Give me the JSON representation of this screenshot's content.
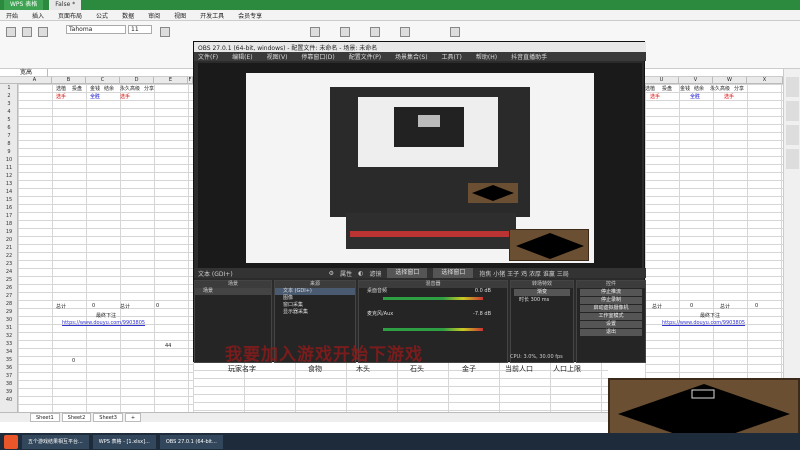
{
  "wps": {
    "app_tab": "WPS 表格",
    "doc_tab": "False *",
    "menu": [
      "开始",
      "插入",
      "页面布局",
      "公式",
      "数据",
      "审阅",
      "视图",
      "开发工具",
      "会员专享"
    ],
    "font": "Tahoma",
    "font_size": "11",
    "cell_ref": "宽高",
    "columns_left": [
      "A",
      "B",
      "C",
      "D",
      "E",
      "F"
    ],
    "columns_right": [
      "U",
      "V",
      "W",
      "X"
    ],
    "rows": [
      "1",
      "2",
      "3",
      "4",
      "5",
      "6",
      "7",
      "8",
      "9",
      "10",
      "11",
      "12",
      "13",
      "14",
      "15",
      "16",
      "17",
      "18",
      "19",
      "20",
      "21",
      "22",
      "23",
      "24",
      "25",
      "26",
      "27",
      "28",
      "29",
      "30",
      "31",
      "32",
      "33",
      "34",
      "35",
      "36",
      "37",
      "38",
      "39",
      "40"
    ],
    "header_row": [
      "选植",
      "投盘",
      "金钱",
      "结余",
      "永久高级",
      "分享"
    ],
    "sub_row": [
      "选手",
      "全胜",
      "选手"
    ],
    "totals": [
      "总计",
      "0",
      "总计",
      "0"
    ],
    "hint": "最终下注",
    "link": "https://www.douyu.com/9903805",
    "value_44": "44",
    "value_0": "0",
    "sheets": [
      "Sheet1",
      "Sheet2",
      "Sheet3",
      "+"
    ]
  },
  "obs": {
    "title": "OBS 27.0.1 (64-bit, windows) - 配置文件: 未命名 - 场景: 未命名",
    "menu": [
      "文件(F)",
      "编辑(E)",
      "视图(V)",
      "停靠窗口(D)",
      "配置文件(P)",
      "场景集合(S)",
      "工具(T)",
      "帮助(H)",
      "抖音直播助手"
    ],
    "status_label": "文本 (GDI+)",
    "props_btn": "属性",
    "filter_btn": "滤镜",
    "select_window": "选择窗口",
    "select_window2": "选择窗口",
    "scroll_text": "抱焦 小猪 王子 鸡 浓厚 谁赢 三局",
    "docks": {
      "scenes": "场景",
      "sources": "来源",
      "mixer": "混音器",
      "transitions": "转场特效",
      "controls": "控件"
    },
    "scene_item": "场景",
    "sources": [
      "文本 (GDI+)",
      "图像",
      "窗口采集",
      "显示器采集"
    ],
    "mixer_items": [
      "桌面音频",
      "麦克风/Aux"
    ],
    "mixer_db": [
      "0.0 dB",
      "-7.8 dB"
    ],
    "transition": "渐变",
    "duration_label": "时长",
    "duration": "300 ms",
    "controls": [
      "停止推流",
      "停止录制",
      "启动虚拟摄像机",
      "工作室模式",
      "设置",
      "退出"
    ],
    "status_bar": "CPU: 3.0%, 30.00 fps"
  },
  "game": {
    "headers": [
      "玩家名字",
      "食物",
      "木头",
      "石头",
      "金子",
      "当前人口",
      "人口上限"
    ],
    "overlay": "我要加入游戏开始下游戏"
  },
  "taskbar": [
    "五个游戏结果相互平台...",
    "WPS 表格 - [1.xlsx]...",
    "OBS 27.0.1 (64-bit..."
  ],
  "colors": {
    "wps_green": "#2b8a3e",
    "obs_dark": "#2b2b2b",
    "red_text": "#dd0000",
    "wood": "#6b4f32"
  }
}
